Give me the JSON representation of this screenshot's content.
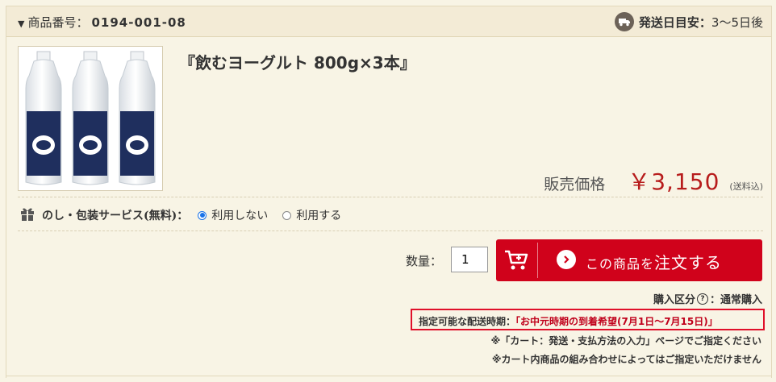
{
  "header": {
    "product_number_label": "商品番号：",
    "product_number": "0194-001-08",
    "shipping_label": "発送日目安：",
    "shipping_value": "3〜5日後"
  },
  "product": {
    "title": "『飲むヨーグルト 800g×3本』",
    "price_label": "販売価格",
    "price": "￥3,150",
    "price_note": "(送料込)"
  },
  "noshi": {
    "label": "のし・包装サービス(無料)：",
    "options": [
      "利用しない",
      "利用する"
    ],
    "selected": "利用しない"
  },
  "order": {
    "qty_label": "数量：",
    "qty_value": "1",
    "cart_button_label_pre": "この商品",
    "cart_button_label_mid": "を",
    "cart_button_label_post": "注文する"
  },
  "purchase_type": {
    "label": "購入区分",
    "value": "：通常購入"
  },
  "delivery": {
    "label": "指定可能な配送時期：",
    "value": "「お中元時期の到着希望(7月1日〜7月15日)」"
  },
  "notes": [
    "※「カート：発送・支払方法の入力」ページでご指定ください",
    "※カート内商品の組み合わせによってはご指定いただけません"
  ],
  "colors": {
    "accent_red": "#d0021b",
    "background": "#f8f4e5",
    "bottle_label": "#1f2f5e"
  }
}
